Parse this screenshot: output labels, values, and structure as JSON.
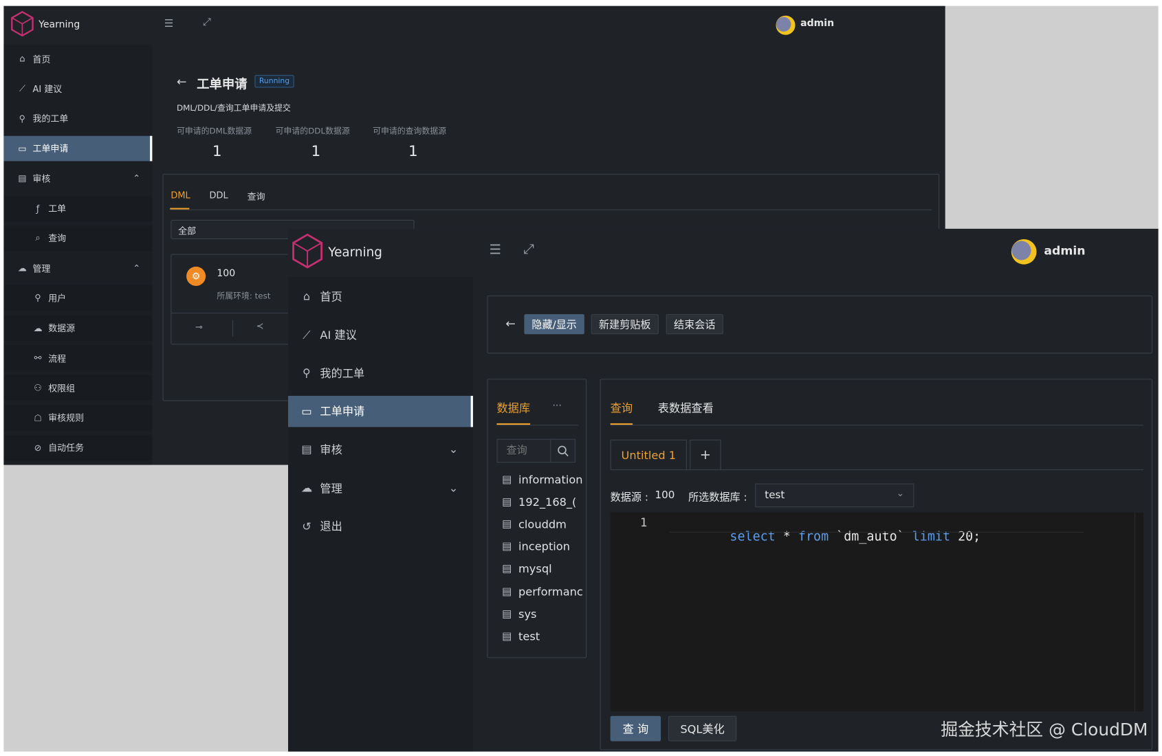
{
  "back_window": {
    "brand": "Yearning",
    "user": "admin",
    "sidebar": [
      {
        "label": "首页",
        "icon": "home-icon"
      },
      {
        "label": "AI 建议",
        "icon": "chart-icon"
      },
      {
        "label": "我的工单",
        "icon": "user-icon"
      },
      {
        "label": "工单申请",
        "icon": "monitor-icon",
        "active": true
      },
      {
        "label": "审核",
        "icon": "audit-icon",
        "expand": "⌃"
      },
      {
        "label": "工单",
        "icon": "fx-icon",
        "sub": true
      },
      {
        "label": "查询",
        "icon": "search-icon",
        "sub": true
      },
      {
        "label": "管理",
        "icon": "cloud-icon",
        "expand": "⌃"
      },
      {
        "label": "用户",
        "icon": "user-icon",
        "sub": true
      },
      {
        "label": "数据源",
        "icon": "cloud-icon",
        "sub": true
      },
      {
        "label": "流程",
        "icon": "flow-icon",
        "sub": true
      },
      {
        "label": "权限组",
        "icon": "group-icon",
        "sub": true
      },
      {
        "label": "审核规则",
        "icon": "rule-icon",
        "sub": true
      },
      {
        "label": "自动任务",
        "icon": "task-icon",
        "sub": true
      }
    ],
    "page_title": "工单申请",
    "status_badge": "Running",
    "subtitle": "DML/DDL/查询工单申请及提交",
    "stats": [
      {
        "label": "可申请的DML数据源",
        "value": "1"
      },
      {
        "label": "可申请的DDL数据源",
        "value": "1"
      },
      {
        "label": "可申请的查询数据源",
        "value": "1"
      }
    ],
    "tabs": [
      "DML",
      "DDL",
      "查询"
    ],
    "filter_value": "全部",
    "card": {
      "title": "100",
      "env": "所属环境: test"
    }
  },
  "front_window": {
    "brand": "Yearning",
    "user": "admin",
    "sidebar": [
      {
        "label": "首页",
        "icon": "home-icon"
      },
      {
        "label": "AI 建议",
        "icon": "chart-icon"
      },
      {
        "label": "我的工单",
        "icon": "user-icon"
      },
      {
        "label": "工单申请",
        "icon": "monitor-icon",
        "active": true
      },
      {
        "label": "审核",
        "icon": "audit-icon",
        "expand": "⌄"
      },
      {
        "label": "管理",
        "icon": "cloud-icon",
        "expand": "⌄"
      },
      {
        "label": "退出",
        "icon": "logout-icon"
      }
    ],
    "toolbar": {
      "toggle": "隐藏/显示",
      "new_clipboard": "新建剪贴板",
      "end_session": "结束会话"
    },
    "db_panel": {
      "tab": "数据库",
      "more": "···",
      "search_placeholder": "查询",
      "databases": [
        "information",
        "192_168_(",
        "clouddm",
        "inception",
        "mysql",
        "performanc",
        "sys",
        "test"
      ]
    },
    "query_panel": {
      "tabs": [
        "查询",
        "表数据查看"
      ],
      "editor_tab": "Untitled 1",
      "add_tab": "+",
      "datasource_label": "数据源 :",
      "datasource_value": "100",
      "database_label": "所选数据库 :",
      "database_value": "test",
      "line_number": "1",
      "sql_tokens": [
        "select",
        " * ",
        "from",
        " `dm_auto` ",
        "limit",
        " 20;"
      ],
      "run_button": "查 询",
      "beautify_button": "SQL美化"
    }
  },
  "watermark": "掘金技术社区 @ CloudDM"
}
